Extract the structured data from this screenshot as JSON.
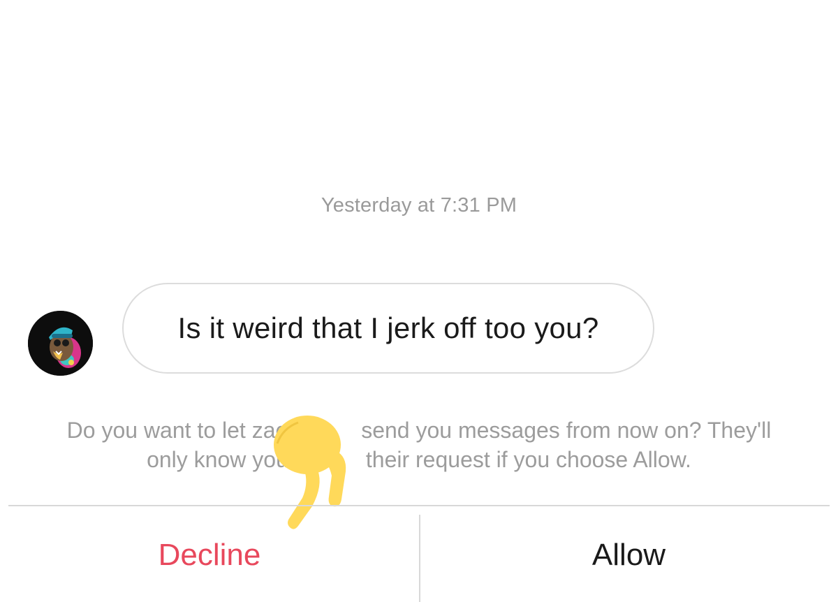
{
  "conversation": {
    "timestamp": "Yesterday at 7:31 PM",
    "message": {
      "text": "Is it weird that I jerk off too you?"
    }
  },
  "request_prompt": {
    "line1": "Do you want to let zach          send you messages from now on? They'll",
    "line2": "only know you'v          their request if you choose Allow."
  },
  "actions": {
    "decline_label": "Decline",
    "allow_label": "Allow"
  },
  "colors": {
    "decline": "#e8485c",
    "allow": "#1a1a1a",
    "secondary_text": "#9c9c9c",
    "bubble_border": "#dcdcdc",
    "overlay_emoji": "#ffd95a"
  },
  "icons": {
    "overlay": "pointing-hand-emoji",
    "avatar": "profile-avatar"
  }
}
